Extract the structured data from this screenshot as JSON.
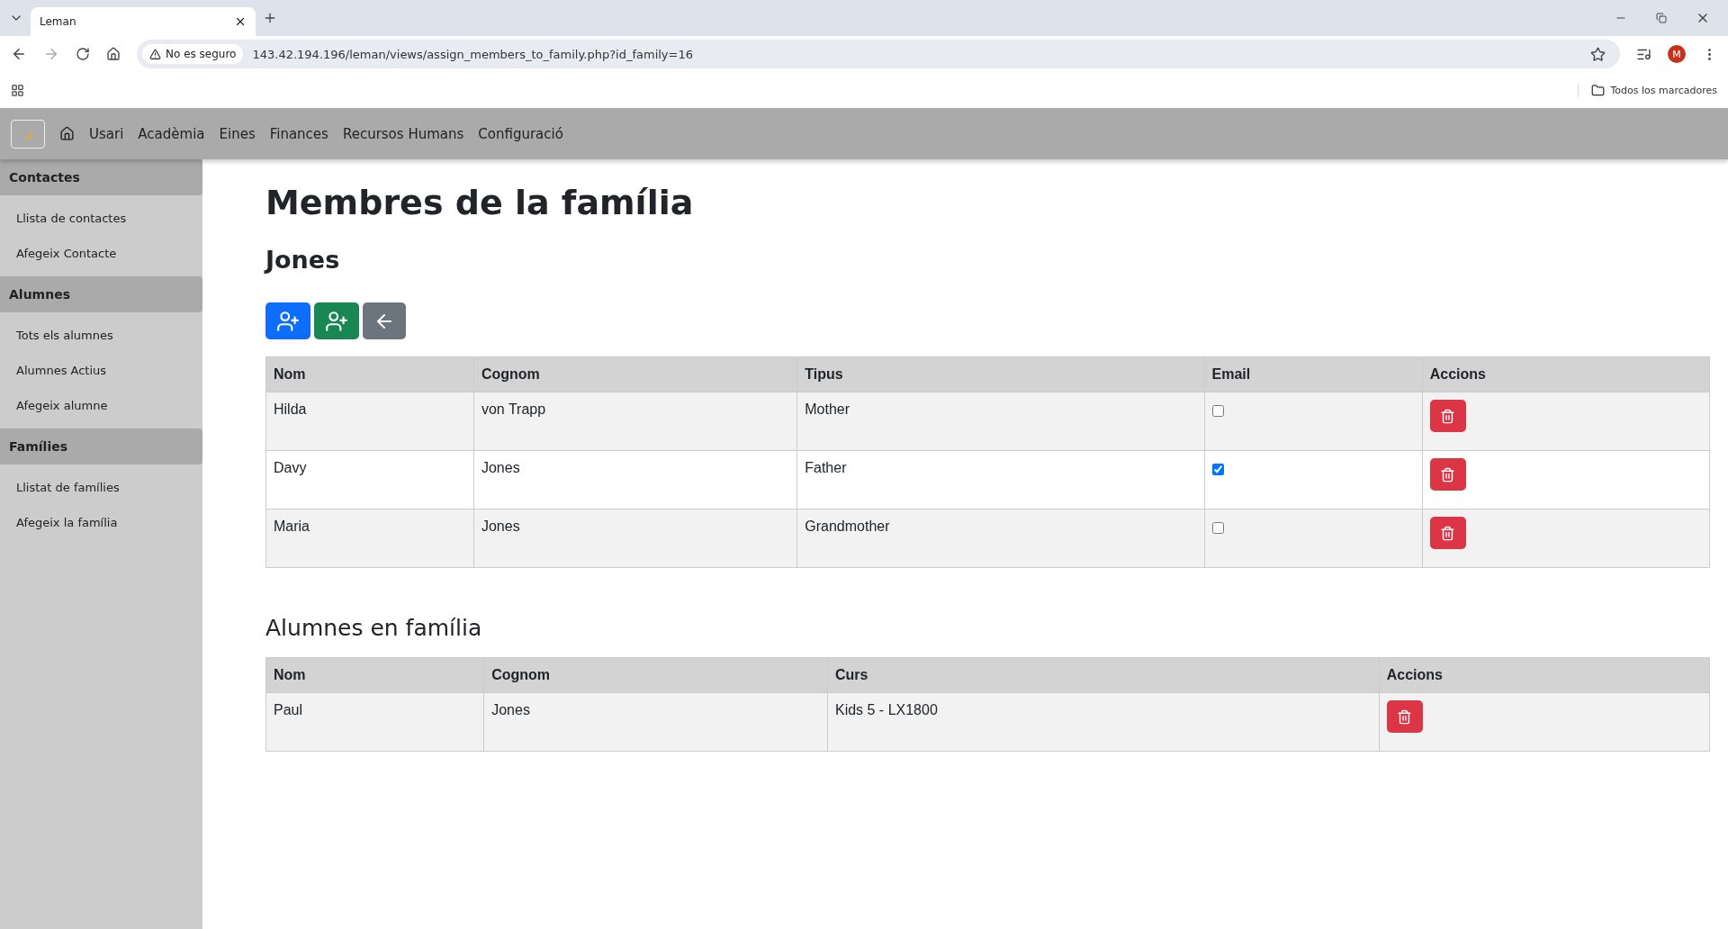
{
  "browser": {
    "tab_title": "Leman",
    "security_label": "No es seguro",
    "url": "143.42.194.196/leman/views/assign_members_to_family.php?id_family=16",
    "profile_initial": "M",
    "bookmarks_label": "Todos los marcadores"
  },
  "navbar": {
    "items": [
      "Usari",
      "Acadèmia",
      "Eines",
      "Finances",
      "Recursos Humans",
      "Configuració"
    ]
  },
  "sidebar": {
    "sections": [
      {
        "title": "Contactes",
        "items": [
          "Llista de contactes",
          "Afegeix Contacte"
        ]
      },
      {
        "title": "Alumnes",
        "items": [
          "Tots els alumnes",
          "Alumnes Actius",
          "Afegeix alumne"
        ]
      },
      {
        "title": "Famílies",
        "items": [
          "Llistat de famílies",
          "Afegeix la família"
        ]
      }
    ]
  },
  "page": {
    "title": "Membres de la família",
    "family_name": "Jones",
    "actions": [
      {
        "kind": "add_member",
        "color": "#0d6efd"
      },
      {
        "kind": "add_student",
        "color": "#198754"
      },
      {
        "kind": "back",
        "color": "#6c757d"
      }
    ],
    "members_table": {
      "columns": [
        "Nom",
        "Cognom",
        "Tipus",
        "Email",
        "Accions"
      ],
      "rows": [
        {
          "nom": "Hilda",
          "cognom": "von Trapp",
          "tipus": "Mother",
          "email_checked": false
        },
        {
          "nom": "Davy",
          "cognom": "Jones",
          "tipus": "Father",
          "email_checked": true
        },
        {
          "nom": "Maria",
          "cognom": "Jones",
          "tipus": "Grandmother",
          "email_checked": false
        }
      ]
    },
    "students_title": "Alumnes en família",
    "students_table": {
      "columns": [
        "Nom",
        "Cognom",
        "Curs",
        "Accions"
      ],
      "rows": [
        {
          "nom": "Paul",
          "cognom": "Jones",
          "curs": "Kids 5 - LX1800"
        }
      ]
    }
  }
}
